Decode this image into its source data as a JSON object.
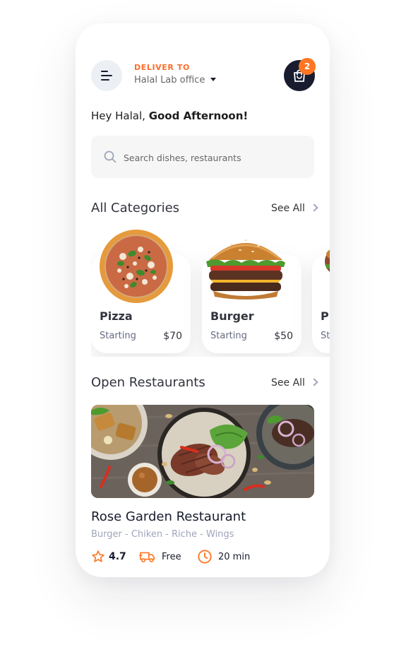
{
  "header": {
    "deliver_label": "DELIVER TO",
    "location": "Halal Lab office",
    "cart_count": "2"
  },
  "greeting": {
    "prefix": "Hey Halal, ",
    "emphasis": "Good Afternoon!"
  },
  "search": {
    "placeholder": "Search dishes, restaurants"
  },
  "categories": {
    "title": "All Categories",
    "see_all": "See All",
    "items": [
      {
        "name": "Pizza",
        "starting_label": "Starting",
        "price": "$70"
      },
      {
        "name": "Burger",
        "starting_label": "Starting",
        "price": "$50"
      },
      {
        "name": "Pi",
        "starting_label": "St",
        "price": ""
      }
    ]
  },
  "restaurants": {
    "title": "Open Restaurants",
    "see_all": "See All",
    "items": [
      {
        "name": "Rose Garden Restaurant",
        "tags": "Burger - Chiken - Riche - Wings",
        "rating": "4.7",
        "delivery": "Free",
        "time": "20 min"
      }
    ]
  },
  "colors": {
    "accent": "#FF7622",
    "dark": "#181C2E",
    "muted": "#A0A5BA",
    "input_bg": "#F6F6F6"
  },
  "icons": [
    "menu-icon",
    "caret-down-icon",
    "shopping-bag-icon",
    "search-icon",
    "chevron-right-icon",
    "star-icon",
    "delivery-truck-icon",
    "clock-icon"
  ]
}
